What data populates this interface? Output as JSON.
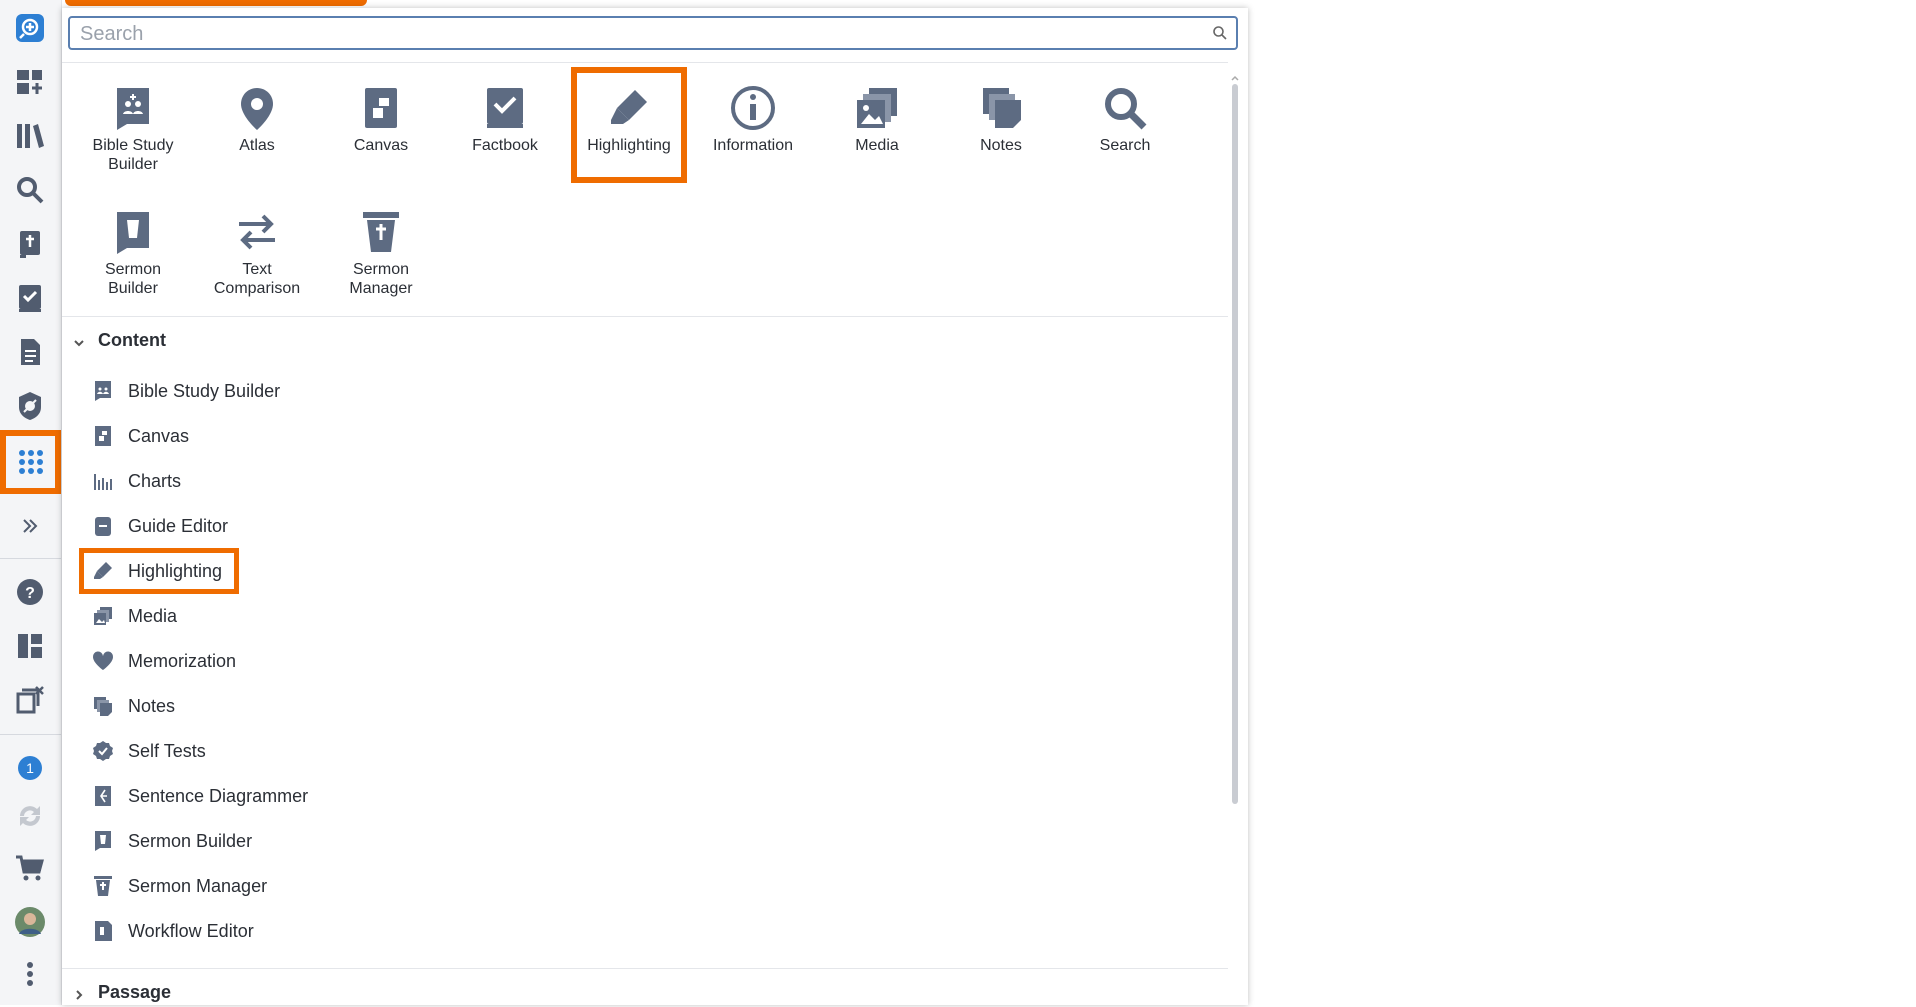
{
  "search": {
    "placeholder": "Search"
  },
  "tools": [
    {
      "label": "Bible Study Builder",
      "icon": "bible-study-builder-icon"
    },
    {
      "label": "Atlas",
      "icon": "atlas-icon"
    },
    {
      "label": "Canvas",
      "icon": "canvas-icon"
    },
    {
      "label": "Factbook",
      "icon": "factbook-icon"
    },
    {
      "label": "Highlighting",
      "icon": "highlighter-icon",
      "selected": true
    },
    {
      "label": "Information",
      "icon": "information-icon"
    },
    {
      "label": "Media",
      "icon": "media-icon"
    },
    {
      "label": "Notes",
      "icon": "notes-icon"
    },
    {
      "label": "Search",
      "icon": "search-icon"
    },
    {
      "label": "Sermon Builder",
      "icon": "sermon-builder-icon"
    },
    {
      "label": "Text Comparison",
      "icon": "text-comparison-icon"
    },
    {
      "label": "Sermon Manager",
      "icon": "sermon-manager-icon"
    }
  ],
  "sections": {
    "content": {
      "title": "Content",
      "items": [
        {
          "label": "Bible Study Builder",
          "icon": "bible-study-builder-icon"
        },
        {
          "label": "Canvas",
          "icon": "canvas-icon"
        },
        {
          "label": "Charts",
          "icon": "charts-icon"
        },
        {
          "label": "Guide Editor",
          "icon": "guide-editor-icon"
        },
        {
          "label": "Highlighting",
          "icon": "highlighter-icon",
          "selected": true
        },
        {
          "label": "Media",
          "icon": "media-icon"
        },
        {
          "label": "Memorization",
          "icon": "heart-icon"
        },
        {
          "label": "Notes",
          "icon": "notes-icon"
        },
        {
          "label": "Self Tests",
          "icon": "self-tests-icon"
        },
        {
          "label": "Sentence Diagrammer",
          "icon": "sentence-diagrammer-icon"
        },
        {
          "label": "Sermon Builder",
          "icon": "sermon-builder-icon"
        },
        {
          "label": "Sermon Manager",
          "icon": "sermon-manager-icon"
        },
        {
          "label": "Workflow Editor",
          "icon": "workflow-editor-icon"
        }
      ]
    },
    "passage": {
      "title": "Passage"
    }
  },
  "rail": {
    "notification_count": "1",
    "items": [
      "logo-icon",
      "add-layout-icon",
      "library-icon",
      "search-icon",
      "bible-icon",
      "checklist-icon",
      "document-icon",
      "shield-icon",
      "apps-grid-icon",
      "expand-icon",
      "help-icon",
      "layouts-icon",
      "close-panels-icon",
      "notification-icon",
      "sync-icon",
      "cart-icon",
      "avatar",
      "more-icon"
    ]
  },
  "colors": {
    "accent": "#ef6c00",
    "icon": "#5d6b82",
    "brand": "#2d7fd3"
  }
}
